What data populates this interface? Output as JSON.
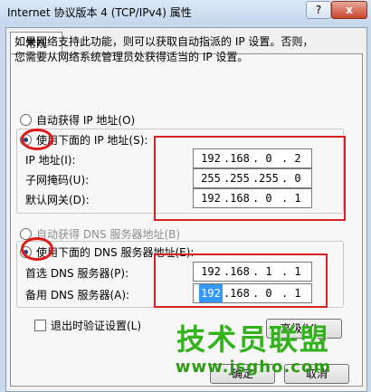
{
  "window": {
    "title": "Internet 协议版本 4 (TCP/IPv4) 属性",
    "help_label": "?",
    "close_label": "x"
  },
  "tab": {
    "label": "常规"
  },
  "description": {
    "line1": "如果网络支持此功能，则可以获取自动指派的 IP 设置。否则，",
    "line2": "您需要从网络系统管理员处获得适当的 IP 设置。"
  },
  "ip_section": {
    "auto_label": "自动获得 IP 地址(O)",
    "manual_label": "使用下面的 IP 地址(S):",
    "selected": "manual",
    "fields": [
      {
        "label": "IP 地址(I):",
        "octets": [
          "192",
          "168",
          "0",
          "2"
        ]
      },
      {
        "label": "子网掩码(U):",
        "octets": [
          "255",
          "255",
          "255",
          "0"
        ]
      },
      {
        "label": "默认网关(D):",
        "octets": [
          "192",
          "168",
          "0",
          "1"
        ]
      }
    ]
  },
  "dns_section": {
    "auto_label": "自动获得 DNS 服务器地址(B)",
    "manual_label": "使用下面的 DNS 服务器地址(E):",
    "selected": "manual",
    "fields": [
      {
        "label": "首选 DNS 服务器(P):",
        "octets": [
          "192",
          "168",
          "1",
          "1"
        ]
      },
      {
        "label": "备用 DNS 服务器(A):",
        "octets": [
          "192",
          "168",
          "0",
          "1"
        ],
        "selected_octet": 0
      }
    ]
  },
  "validate_checkbox": {
    "label": "退出时验证设置(L)",
    "checked": false
  },
  "buttons": {
    "advanced": "高级(V)...",
    "ok": "确定",
    "cancel": "取消"
  },
  "watermark": {
    "main": "技术员联盟",
    "url": "www.jsgho.com"
  },
  "colors": {
    "annotation": "#d72020",
    "selection": "#3399ff",
    "watermark": "#33b21d"
  }
}
